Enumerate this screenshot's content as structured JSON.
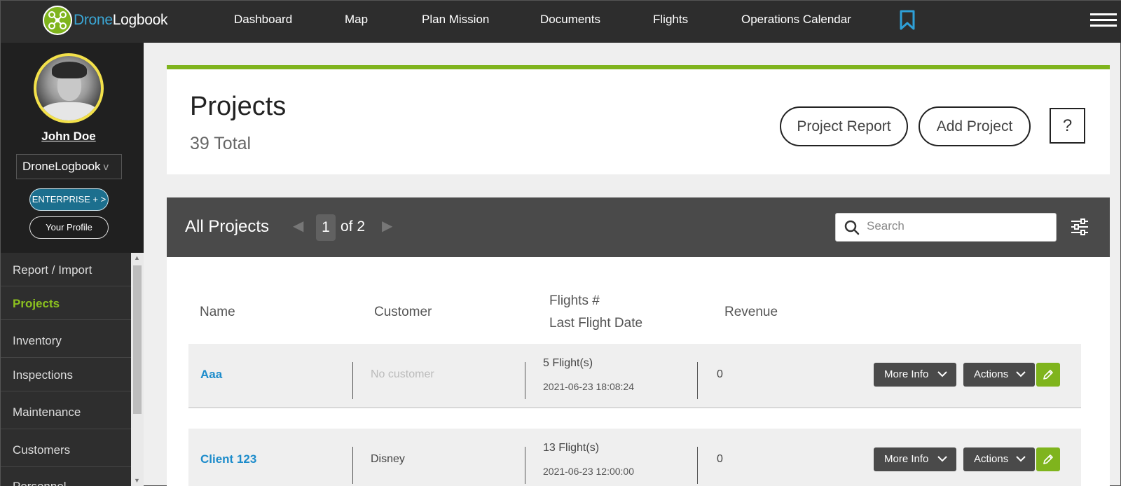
{
  "app": {
    "brand_part1": "Drone",
    "brand_part2": "Logbook"
  },
  "nav": {
    "items": [
      "Dashboard",
      "Map",
      "Plan Mission",
      "Documents",
      "Flights",
      "Operations Calendar"
    ]
  },
  "user": {
    "name": "John Doe",
    "org": "DroneLogbook",
    "org_chevron": "v",
    "plan_button": "ENTERPRISE + >",
    "profile_button": "Your Profile"
  },
  "sidebar": {
    "items": [
      {
        "label": "Report / Import",
        "active": false
      },
      {
        "label": "Projects",
        "active": true
      },
      {
        "label": "Inventory",
        "active": false
      },
      {
        "label": "Inspections",
        "active": false
      },
      {
        "label": "Maintenance",
        "active": false
      },
      {
        "label": "Customers",
        "active": false
      },
      {
        "label": "Personnel",
        "active": false
      }
    ]
  },
  "header": {
    "title": "Projects",
    "total": "39 Total",
    "report_button": "Project Report",
    "add_button": "Add Project",
    "help_button": "?"
  },
  "toolbar": {
    "title": "All Projects",
    "page_current": "1",
    "page_of": "of 2",
    "search_placeholder": "Search"
  },
  "columns": {
    "name": "Name",
    "customer": "Customer",
    "flights": "Flights #",
    "last_flight": "Last Flight Date",
    "revenue": "Revenue"
  },
  "rows": [
    {
      "name": "Aaa",
      "customer": "No customer",
      "customer_empty": true,
      "flights": "5 Flight(s)",
      "date": "2021-06-23 18:08:24",
      "revenue": "0",
      "more_info": "More Info",
      "actions": "Actions"
    },
    {
      "name": "Client 123",
      "customer": "Disney",
      "customer_empty": false,
      "flights": "13 Flight(s)",
      "date": "2021-06-23 12:00:00",
      "revenue": "0",
      "more_info": "More Info",
      "actions": "Actions"
    }
  ],
  "colors": {
    "accent_green": "#7fb41d",
    "link_blue": "#1d8ccb",
    "nav_bg": "#2d2d2d"
  }
}
